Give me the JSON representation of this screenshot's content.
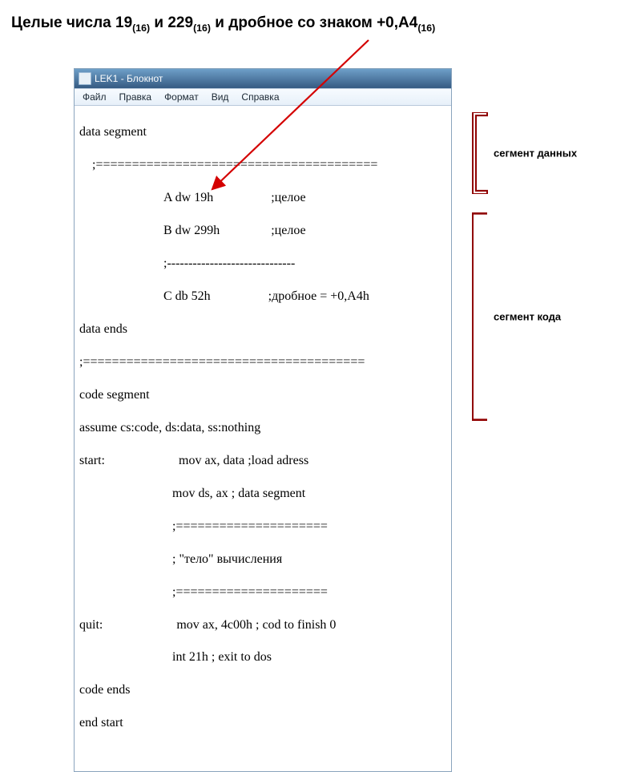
{
  "title_parts": {
    "t1": "Целые числа 19",
    "s1": "(16)",
    "t2": " и 229",
    "s2": "(16)",
    "t3": " и дробное со знаком +0,А4",
    "s3": "(16)"
  },
  "window": {
    "title": "LEK1 - Блокнот",
    "menu": [
      "Файл",
      "Правка",
      "Формат",
      "Вид",
      "Справка"
    ]
  },
  "code": {
    "l01": "data segment",
    "l02": "    ;=======================================",
    "l03": "A dw 19h                  ;целое",
    "l04": "B dw 299h                ;целое",
    "l05": ";------------------------------",
    "l06": "C db 52h                  ;дробное = +0,A4h",
    "l07": "data ends",
    "l08": ";=======================================",
    "l09": "code segment",
    "l10": "assume cs:code, ds:data, ss:nothing",
    "l11a": "start:",
    "l11b": "mov ax, data ;load adress",
    "l12": "mov ds, ax ; data segment",
    "l13": ";=====================",
    "l14": "; \"тело\" вычисления",
    "l15": ";=====================",
    "l16a": "quit:",
    "l16b": "mov ax, 4c00h ; cod to finish 0",
    "l17": "int 21h ; exit to dos",
    "l18": "code ends",
    "l19": "end start"
  },
  "labels": {
    "data_segment": "сегмент данных",
    "code_segment": "сегмент кода"
  },
  "colors": {
    "arrow": "#d40000",
    "bracket": "#900000"
  }
}
